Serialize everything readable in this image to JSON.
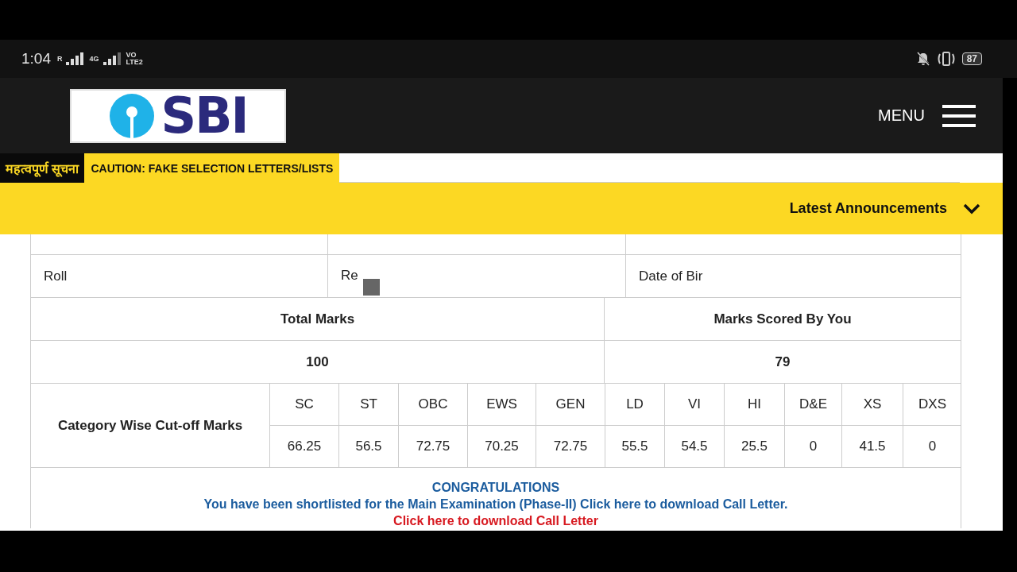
{
  "status_bar": {
    "time": "1:04",
    "network_labels": [
      "R",
      "4G",
      "VO",
      "LTE2"
    ],
    "battery": "87"
  },
  "header": {
    "logo_text": "SBI",
    "menu_label": "MENU"
  },
  "notice": {
    "label": "महत्वपूर्ण सूचना",
    "text": "CAUTION: FAKE SELECTION LETTERS/LISTS"
  },
  "announcements": {
    "label": "Latest Announcements",
    "expanded": false
  },
  "candidate_row": [
    "Roll",
    "Re",
    "Date of Bir"
  ],
  "marks": {
    "headers": [
      "Total Marks",
      "Marks Scored By You"
    ],
    "values": [
      "100",
      "79"
    ]
  },
  "cutoff": {
    "label": "Category Wise Cut-off Marks",
    "categories": [
      "SC",
      "ST",
      "OBC",
      "EWS",
      "GEN",
      "LD",
      "VI",
      "HI",
      "D&E",
      "XS",
      "DXS"
    ],
    "values": [
      "66.25",
      "56.5",
      "72.75",
      "70.25",
      "72.75",
      "55.5",
      "54.5",
      "25.5",
      "0",
      "41.5",
      "0"
    ]
  },
  "result": {
    "heading": "CONGRATULATIONS",
    "message": "You have been shortlisted for the Main Examination (Phase-II) Click here to download Call Letter.",
    "link": "Click here to download Call Letter"
  }
}
